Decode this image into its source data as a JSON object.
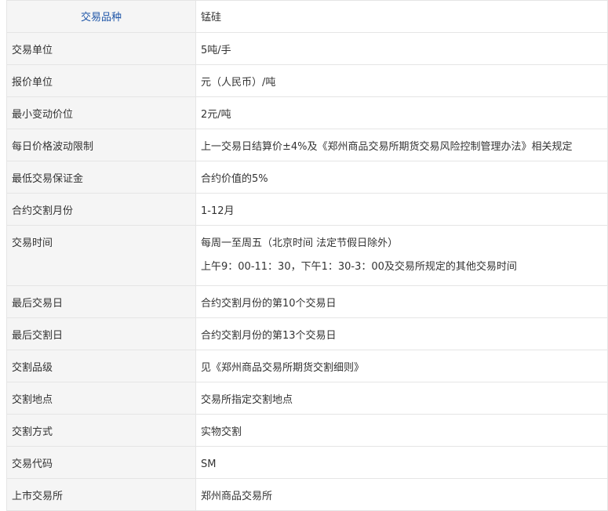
{
  "table": {
    "header": {
      "label": "交易品种",
      "value": "锰硅"
    },
    "rows": [
      {
        "label": "交易单位",
        "value": "5吨/手"
      },
      {
        "label": "报价单位",
        "value": "元（人民币）/吨"
      },
      {
        "label": "最小变动价位",
        "value": "2元/吨"
      },
      {
        "label": "每日价格波动限制",
        "value": "上一交易日结算价±4%及《郑州商品交易所期货交易风险控制管理办法》相关规定"
      },
      {
        "label": "最低交易保证金",
        "value": "合约价值的5%"
      },
      {
        "label": "合约交割月份",
        "value": "1-12月"
      },
      {
        "label": "交易时间",
        "line1": "每周一至周五（北京时间 法定节假日除外）",
        "line2": "上午9：00-11：30，下午1：30-3：00及交易所规定的其他交易时间"
      },
      {
        "label": "最后交易日",
        "value": "合约交割月份的第10个交易日"
      },
      {
        "label": "最后交割日",
        "value": "合约交割月份的第13个交易日"
      },
      {
        "label": "交割品级",
        "value": "见《郑州商品交易所期货交割细则》"
      },
      {
        "label": "交割地点",
        "value": "交易所指定交割地点"
      },
      {
        "label": "交割方式",
        "value": "实物交割"
      },
      {
        "label": "交易代码",
        "value": "SM"
      },
      {
        "label": "上市交易所",
        "value": "郑州商品交易所"
      }
    ]
  }
}
